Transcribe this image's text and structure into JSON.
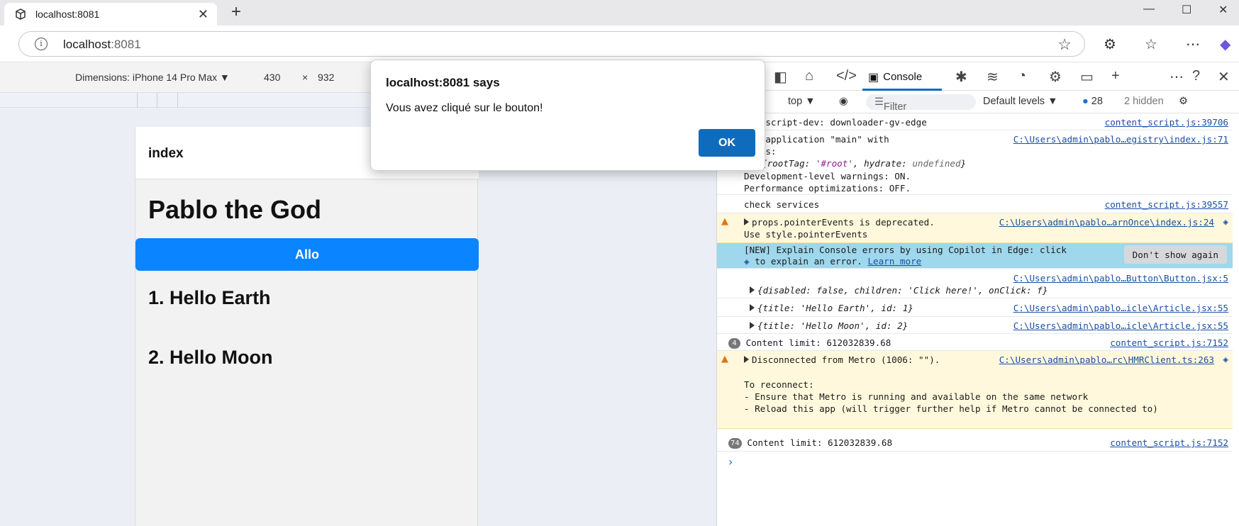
{
  "browser": {
    "tab_title": "localhost:8081",
    "url_host": "localhost",
    "url_port": ":8081"
  },
  "device_toolbar": {
    "dimensions_label": "Dimensions: iPhone 14 Pro Max",
    "width": "430",
    "times": "×",
    "height": "932"
  },
  "app": {
    "header_title": "index",
    "heading": "Pablo the God",
    "button_label": "Allo",
    "articles": [
      "1. Hello Earth",
      "2. Hello Moon"
    ]
  },
  "dialog": {
    "title": "localhost:8081 says",
    "message": "Vous avez cliqué sur le bouton!",
    "ok_label": "OK"
  },
  "devtools": {
    "console_tab_label": "Console",
    "context": "top",
    "filter_placeholder": "Filter",
    "levels": "Default levels",
    "issues_count": "28",
    "hidden_count": "2 hidden",
    "messages": {
      "m1_text": "ent-script-dev: downloader-gv-edge",
      "m1_src": "content_script.js:39706",
      "m2_line1": "ing application \"main\" with",
      "m2_line2": "arams:",
      "m2_src": "C:\\Users\\admin\\pablo…egistry\\index.js:71",
      "m2_obj_open": "{",
      "m2_key1": "rootTag",
      "m2_val1": "'#root'",
      "m2_key2": "hydrate",
      "m2_val2": "undefined",
      "m2_obj_close": "}",
      "m2_line4": "Development-level warnings: ON.",
      "m2_line5": "Performance optimizations: OFF.",
      "m3_text": "check services",
      "m3_src": "content_script.js:39557",
      "m4_line1": "props.pointerEvents is deprecated.",
      "m4_line2": "Use style.pointerEvents",
      "m4_src": "C:\\Users\\admin\\pablo…arnOnce\\index.js:24",
      "m5_line1": "[NEW] Explain Console errors by using Copilot in Edge: click",
      "m5_line2": "to explain an error.",
      "m5_link": "Learn more",
      "m5_button": "Don't show again",
      "m6_src": "C:\\Users\\admin\\pablo…Button\\Button.jsx:5",
      "m6_obj": "{disabled: false, children: 'Click here!', onClick: f}",
      "m7_obj": "{title: 'Hello Earth', id: 1}",
      "m7_src": "C:\\Users\\admin\\pablo…icle\\Article.jsx:55",
      "m8_obj": "{title: 'Hello Moon', id: 2}",
      "m8_src": "C:\\Users\\admin\\pablo…icle\\Article.jsx:55",
      "m9_count": "4",
      "m9_text": "Content limit: 612032839.68",
      "m9_src": "content_script.js:7152",
      "m10_line1": "Disconnected from Metro (1006: \"\").",
      "m10_src": "C:\\Users\\admin\\pablo…rc\\HMRClient.ts:263",
      "m10_line3": "To reconnect:",
      "m10_line4": "- Ensure that Metro is running and available on the same network",
      "m10_line5": "- Reload this app (will trigger further help if Metro cannot be connected to)",
      "m11_count": "74",
      "m11_text": "Content limit: 612032839.68",
      "m11_src": "content_script.js:7152"
    }
  },
  "colors": {
    "accent": "#0f6cbd",
    "app_button": "#0a84ff",
    "warning_bg": "#fff8dc",
    "info_bg": "#9fd7ec"
  }
}
